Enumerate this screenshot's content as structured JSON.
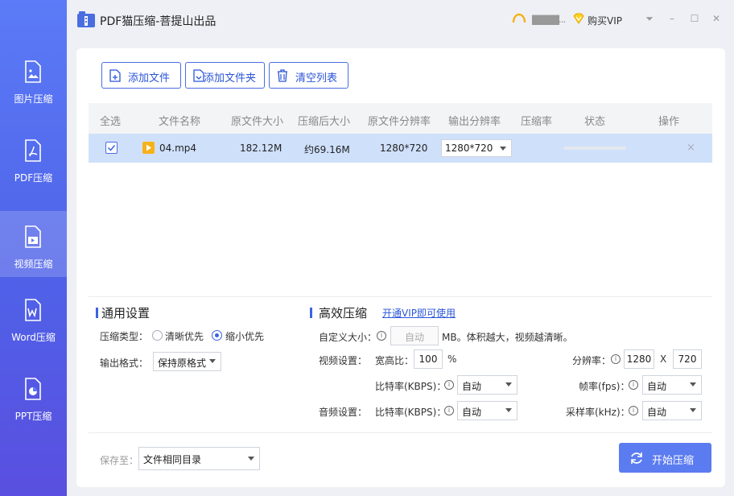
{
  "app": {
    "title": "PDF猫压缩-菩提山出品"
  },
  "header": {
    "username": "▇▇▇▇...",
    "vip_label": "购买VIP"
  },
  "window_controls": {
    "menu": "⏷",
    "minimize": "–",
    "maximize": "☐",
    "close": "✕"
  },
  "sidebar": {
    "items": [
      {
        "label": "图片压缩",
        "icon": "image-file-icon"
      },
      {
        "label": "PDF压缩",
        "icon": "pdf-file-icon"
      },
      {
        "label": "视频压缩",
        "icon": "video-file-icon",
        "active": true
      },
      {
        "label": "Word压缩",
        "icon": "word-file-icon"
      },
      {
        "label": "PPT压缩",
        "icon": "ppt-file-icon"
      }
    ]
  },
  "toolbar": {
    "add_file": "添加文件",
    "add_folder": "添加文件夹",
    "clear_list": "清空列表"
  },
  "table": {
    "headers": [
      "全选",
      "文件名称",
      "原文件大小",
      "压缩后大小",
      "原文件分辨率",
      "输出分辨率",
      "压缩率",
      "状态",
      "操作"
    ],
    "rows": [
      {
        "checked": true,
        "name": "04.mp4",
        "original_size": "182.12M",
        "compressed_size": "约69.16M",
        "original_resolution": "1280*720",
        "output_resolution": "1280*720",
        "ratio": "",
        "progress": 0,
        "delete": "×"
      }
    ]
  },
  "general": {
    "title": "通用设置",
    "type_label": "压缩类型：",
    "options": [
      "清晰优先",
      "缩小优先"
    ],
    "selected": "缩小优先",
    "format_label": "输出格式：",
    "format_value": "保持原格式"
  },
  "efficient": {
    "title": "高效压缩",
    "vip_link": "开通VIP即可使用",
    "custom_size_label": "自定义大小：",
    "custom_size_value": "自动",
    "custom_size_hint": "MB。体积越大，视频越清晰。",
    "video_label": "视频设置：",
    "aspect_label": "宽高比：",
    "aspect_value": "100",
    "aspect_unit": "%",
    "resolution_label": "分辨率：",
    "res_w": "1280",
    "res_x": "X",
    "res_h": "720",
    "bitrate_label": "比特率(KBPS)：",
    "bitrate_value": "自动",
    "fps_label": "帧率(fps)：",
    "fps_value": "自动",
    "audio_label": "音频设置：",
    "audio_bitrate_label": "比特率(KBPS)：",
    "audio_bitrate_value": "自动",
    "sample_label": "采样率(kHz)：",
    "sample_value": "自动"
  },
  "footer": {
    "save_label": "保存至：",
    "save_value": "文件相同目录",
    "start": "开始压缩"
  },
  "colors": {
    "accent": "#4a6ee0",
    "sidebar": "#5b7bf7",
    "row_selected": "#cfe0fb",
    "start_button": "#5b7bf0"
  }
}
